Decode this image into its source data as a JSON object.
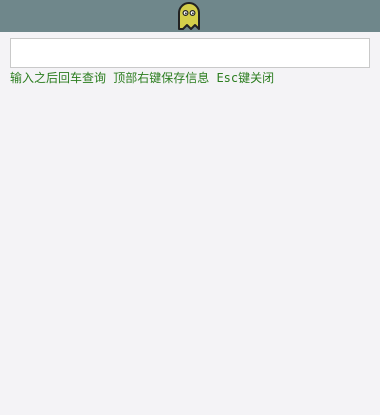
{
  "header": {
    "logo_icon": "ghost-icon",
    "bar_color": "#6f878b",
    "logo_color": "#d4cf4a"
  },
  "search": {
    "value": "",
    "placeholder": ""
  },
  "hint": {
    "text": "输入之后回车查询 顶部右键保存信息 Esc键关闭",
    "color": "#2b7d1f"
  }
}
